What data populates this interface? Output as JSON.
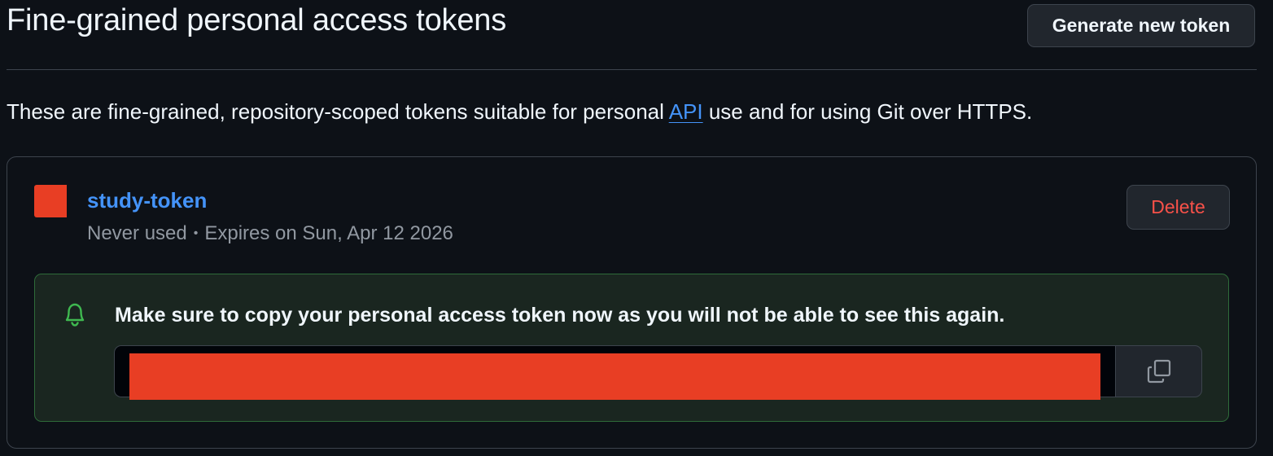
{
  "header": {
    "title": "Fine-grained personal access tokens",
    "generate_button": "Generate new token"
  },
  "description": {
    "before_link": "These are fine-grained, repository-scoped tokens suitable for personal ",
    "link_text": "API",
    "after_link": " use and for using Git over HTTPS."
  },
  "token": {
    "name": "study-token",
    "usage": "Never used",
    "separator": "•",
    "expiry": "Expires on Sun, Apr 12 2026",
    "delete_button": "Delete"
  },
  "notice": {
    "icon": "bell-icon",
    "message": "Make sure to copy your personal access token now as you will not be able to see this again.",
    "copy_icon": "copy-icon"
  },
  "colors": {
    "background": "#0d1117",
    "link": "#4493f8",
    "danger": "#f85149",
    "success_border": "#2e6b39",
    "redaction": "#e83e24"
  }
}
